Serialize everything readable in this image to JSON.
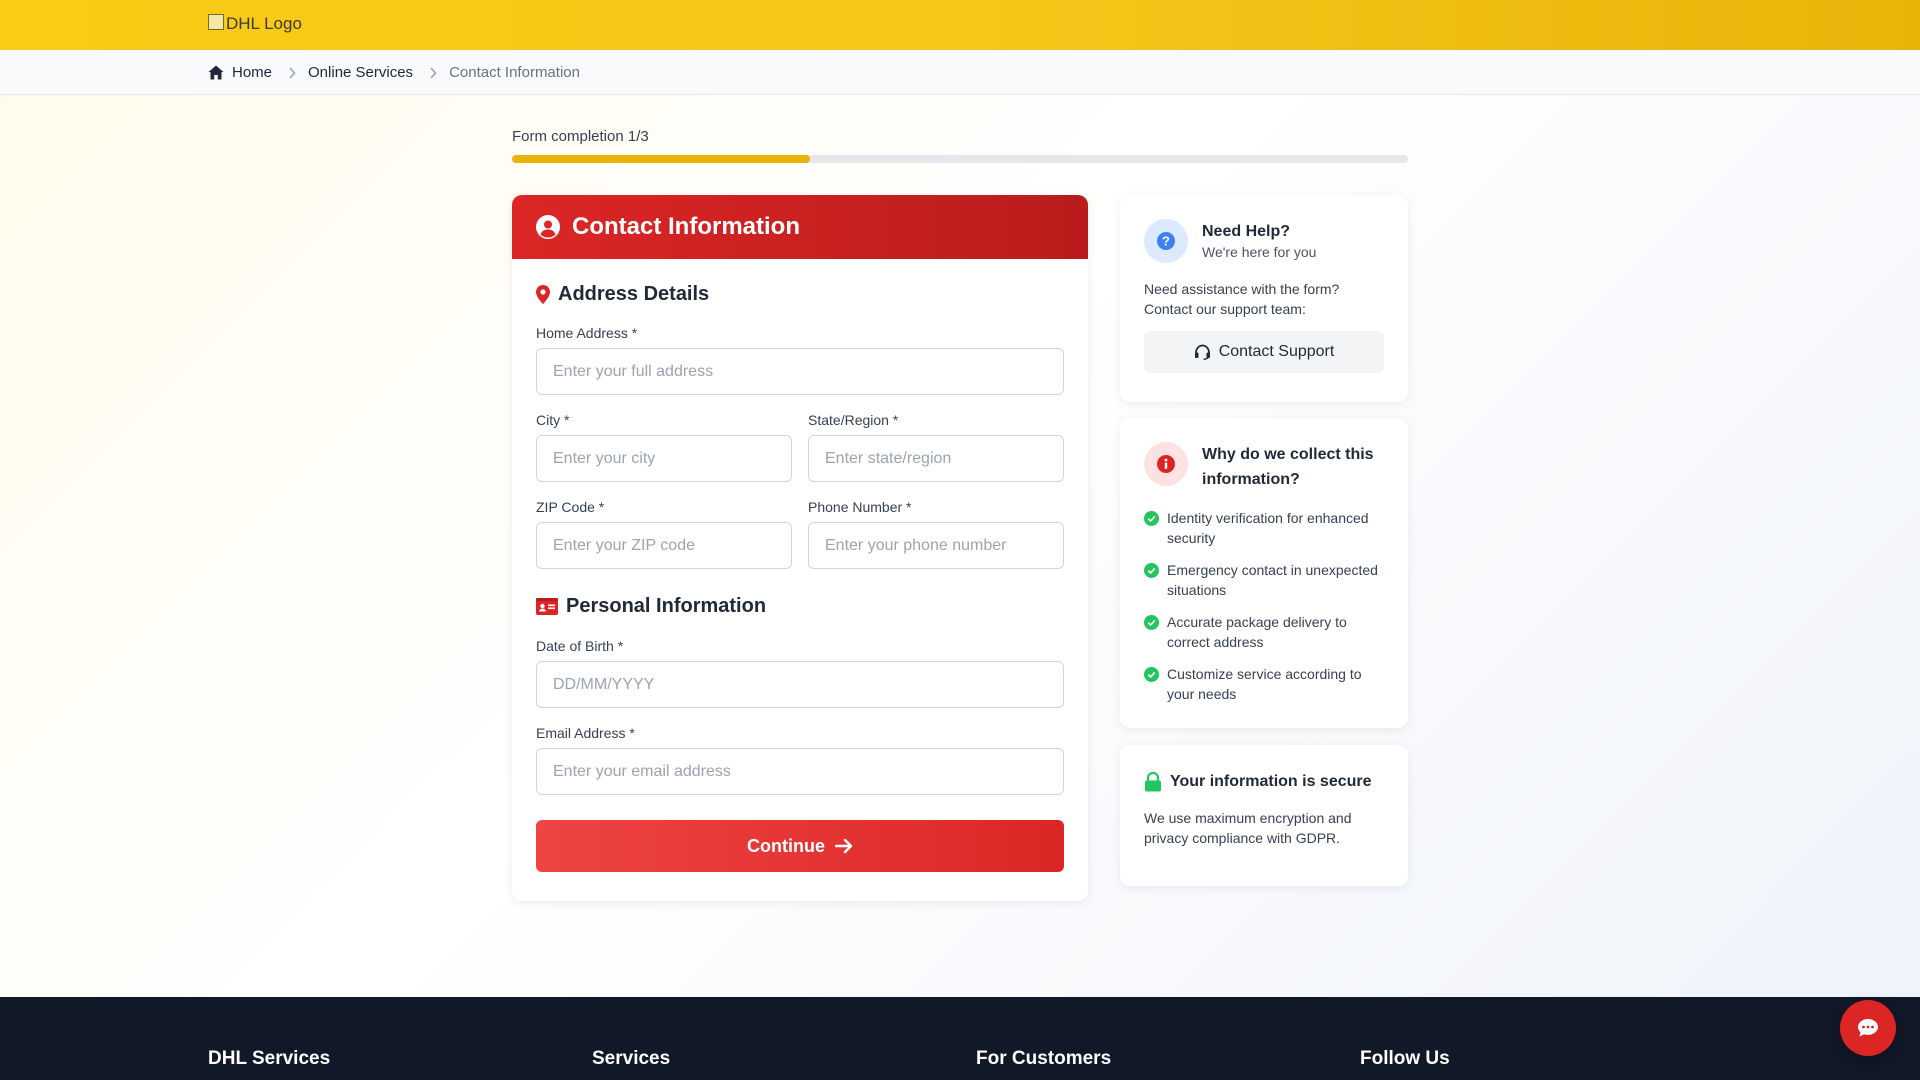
{
  "header": {
    "logo_alt": "DHL Logo"
  },
  "breadcrumb": {
    "items": [
      {
        "label": "Home"
      },
      {
        "label": "Online Services"
      },
      {
        "label": "Contact Information"
      }
    ]
  },
  "progress": {
    "label": "Form completion 1/3",
    "fraction": 0.333
  },
  "form": {
    "title": "Contact Information",
    "address_section": {
      "title": "Address Details",
      "home_address": {
        "label": "Home Address *",
        "placeholder": "Enter your full address",
        "value": ""
      },
      "city": {
        "label": "City *",
        "placeholder": "Enter your city",
        "value": ""
      },
      "state": {
        "label": "State/Region *",
        "placeholder": "Enter state/region",
        "value": ""
      },
      "zip": {
        "label": "ZIP Code *",
        "placeholder": "Enter your ZIP code",
        "value": ""
      },
      "phone": {
        "label": "Phone Number *",
        "placeholder": "Enter your phone number",
        "value": ""
      }
    },
    "personal_section": {
      "title": "Personal Information",
      "dob": {
        "label": "Date of Birth *",
        "placeholder": "DD/MM/YYYY",
        "value": ""
      },
      "email": {
        "label": "Email Address *",
        "placeholder": "Enter your email address",
        "value": ""
      }
    },
    "continue_label": "Continue"
  },
  "help_card": {
    "title": "Need Help?",
    "subtitle": "We're here for you",
    "text": "Need assistance with the form? Contact our support team:",
    "button_label": "Contact Support"
  },
  "why_card": {
    "title": "Why do we collect this information?",
    "reasons": [
      "Identity verification for enhanced security",
      "Emergency contact in unexpected situations",
      "Accurate package delivery to correct address",
      "Customize service according to your needs"
    ]
  },
  "secure_card": {
    "title": "Your information is secure",
    "text": "We use maximum encryption and privacy compliance with GDPR."
  },
  "footer": {
    "columns": [
      "DHL Services",
      "Services",
      "For Customers",
      "Follow Us"
    ]
  },
  "colors": {
    "brand_yellow": "#facc15",
    "brand_red": "#dc2626",
    "success_green": "#22c55e",
    "info_blue": "#3b82f6"
  },
  "icons": {
    "home": "home-icon",
    "chevron": "chevron-right-icon",
    "user": "user-circle-icon",
    "pin": "map-pin-icon",
    "id_card": "id-card-icon",
    "arrow": "arrow-right-icon",
    "question": "question-circle-icon",
    "headset": "headset-icon",
    "info": "info-circle-icon",
    "check": "check-circle-icon",
    "lock": "lock-icon",
    "chat": "chat-icon"
  }
}
